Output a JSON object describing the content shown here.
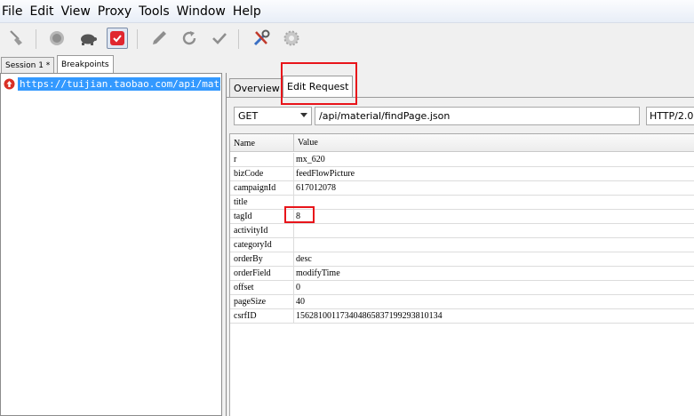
{
  "menu": [
    "File",
    "Edit",
    "View",
    "Proxy",
    "Tools",
    "Window",
    "Help"
  ],
  "toolbar": {
    "icons": [
      "broom-icon",
      "record-icon",
      "turtle-icon",
      "breakpoint-icon",
      "pen-icon",
      "repeat-icon",
      "validate-icon",
      "tools-icon",
      "settings-icon"
    ],
    "accent": "#e0262f"
  },
  "session_tabs": [
    "Session 1 *",
    "Breakpoints"
  ],
  "left": {
    "url": "https://tuijian.taobao.com/api/materia"
  },
  "right_tabs": [
    "Overview",
    "Edit Request"
  ],
  "request": {
    "method": "GET",
    "path": "/api/material/findPage.json",
    "version": "HTTP/2.0"
  },
  "grid": {
    "headers": [
      "Name",
      "Value"
    ],
    "rows": [
      {
        "name": "r",
        "value": "mx_620"
      },
      {
        "name": "bizCode",
        "value": "feedFlowPicture"
      },
      {
        "name": "campaignId",
        "value": "617012078"
      },
      {
        "name": "title",
        "value": ""
      },
      {
        "name": "tagId",
        "value": "8"
      },
      {
        "name": "activityId",
        "value": ""
      },
      {
        "name": "categoryId",
        "value": ""
      },
      {
        "name": "orderBy",
        "value": "desc"
      },
      {
        "name": "orderField",
        "value": "modifyTime"
      },
      {
        "name": "offset",
        "value": "0"
      },
      {
        "name": "pageSize",
        "value": "40"
      },
      {
        "name": "csrfID",
        "value": "156281001173404865837199293810134"
      }
    ]
  },
  "highlight_color": "#e8141a"
}
